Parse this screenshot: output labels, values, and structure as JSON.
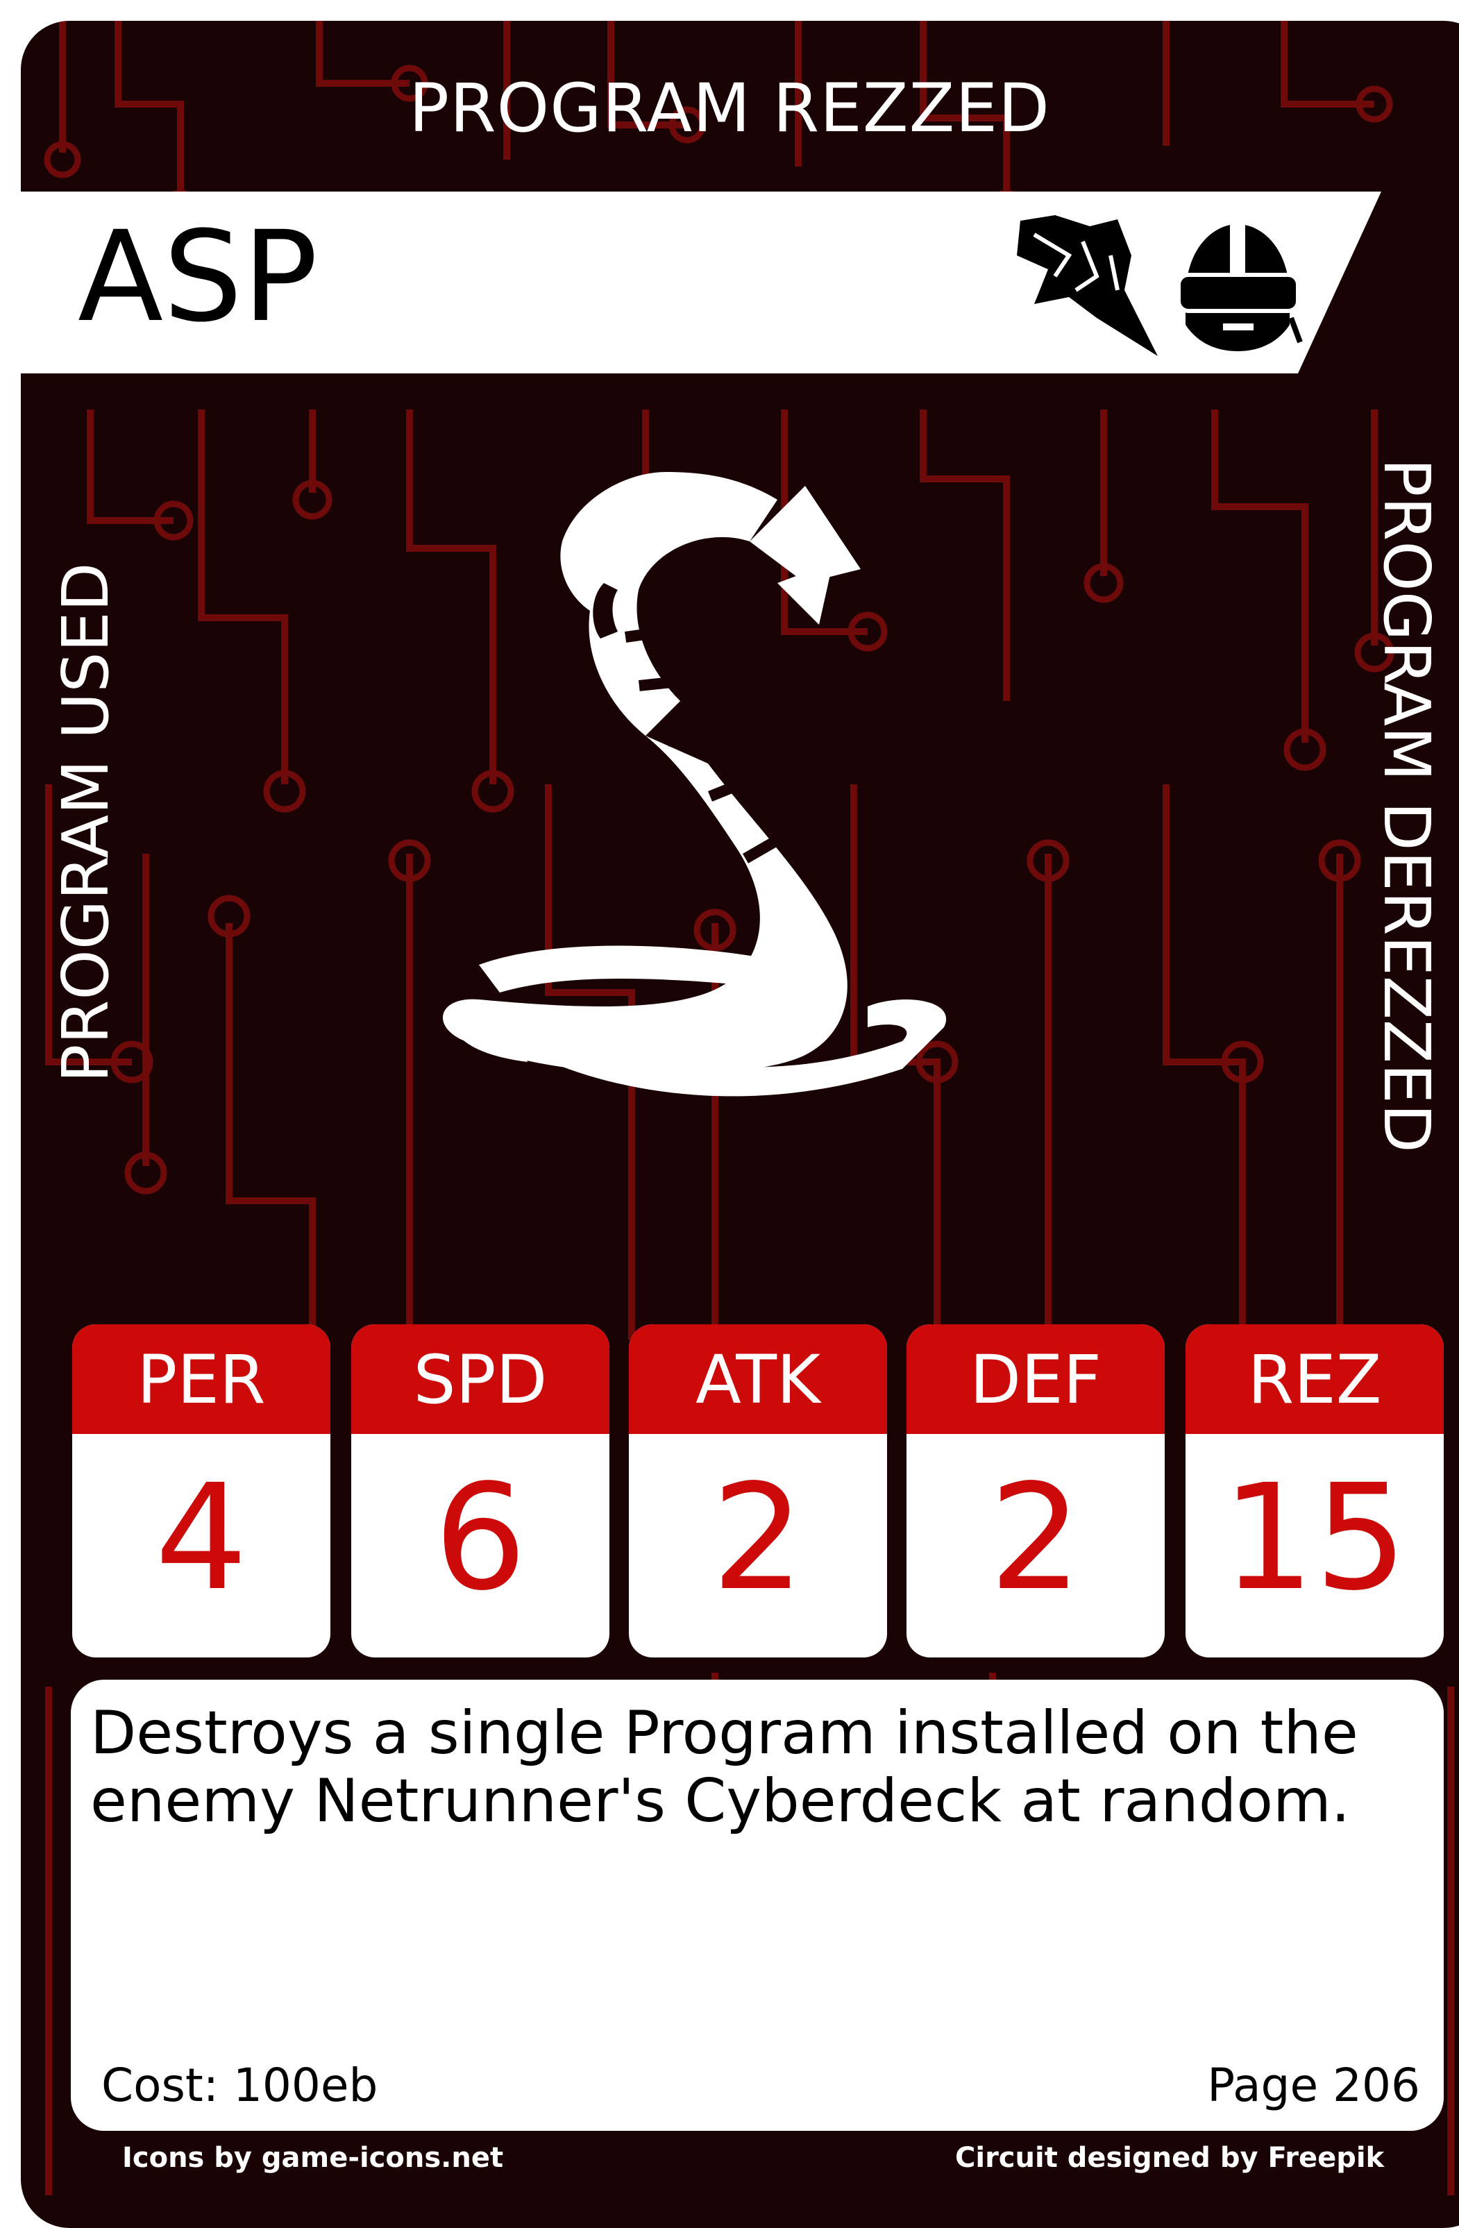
{
  "card": {
    "status_top": "PROGRAM REZZED",
    "status_left": "PROGRAM USED",
    "status_right": "PROGRAM DEREZZED",
    "name": "ASP",
    "type_icons": [
      "black-ice-shard-icon",
      "netrunner-helmet-icon"
    ],
    "art_icon": "cobra-icon",
    "stats": [
      {
        "label": "PER",
        "value": "4"
      },
      {
        "label": "SPD",
        "value": "6"
      },
      {
        "label": "ATK",
        "value": "2"
      },
      {
        "label": "DEF",
        "value": "2"
      },
      {
        "label": "REZ",
        "value": "15"
      }
    ],
    "description": "Destroys a single Program installed on the enemy Netrunner's Cyberdeck at random.",
    "cost": "Cost: 100eb",
    "page": "Page 206",
    "credit_left": "Icons by game-icons.net",
    "credit_right": "Circuit designed by Freepik"
  },
  "colors": {
    "background": "#1a0305",
    "circuit": "#6e0a0a",
    "accent": "#cc0a0a",
    "text_light": "#ffffff"
  }
}
